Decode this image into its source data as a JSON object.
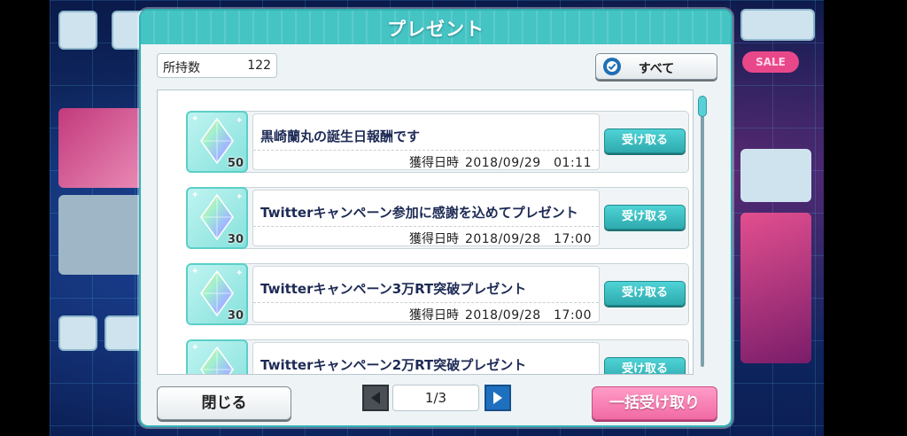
{
  "dialog": {
    "title": "プレゼント"
  },
  "owned": {
    "label": "所持数",
    "value": "122"
  },
  "select_all": {
    "label": "すべて"
  },
  "items": [
    {
      "title": "黒崎蘭丸の誕生日報酬です",
      "quantity": "50",
      "date_label": "獲得日時",
      "date": "2018/09/29　01:11",
      "button": "受け取る"
    },
    {
      "title": "Twitterキャンペーン参加に感謝を込めてプレゼント",
      "quantity": "30",
      "date_label": "獲得日時",
      "date": "2018/09/28　17:00",
      "button": "受け取る"
    },
    {
      "title": "Twitterキャンペーン3万RT突破プレゼント",
      "quantity": "30",
      "date_label": "獲得日時",
      "date": "2018/09/28　17:00",
      "button": "受け取る"
    },
    {
      "title": "Twitterキャンペーン2万RT突破プレゼント",
      "quantity": "",
      "date_label": "",
      "date": "",
      "button": "受け取る"
    }
  ],
  "footer": {
    "close": "閉じる",
    "page": "1/3",
    "bulk_receive": "一括受け取り"
  },
  "background": {
    "sale_badge": "SALE"
  },
  "colors": {
    "accent": "#45c4c4",
    "receive": "#2eaaae",
    "bulk": "#f06aa4"
  },
  "icons": {
    "item": "crystal-icon",
    "check": "check-icon",
    "prev": "prev-page-icon",
    "next": "next-page-icon"
  }
}
